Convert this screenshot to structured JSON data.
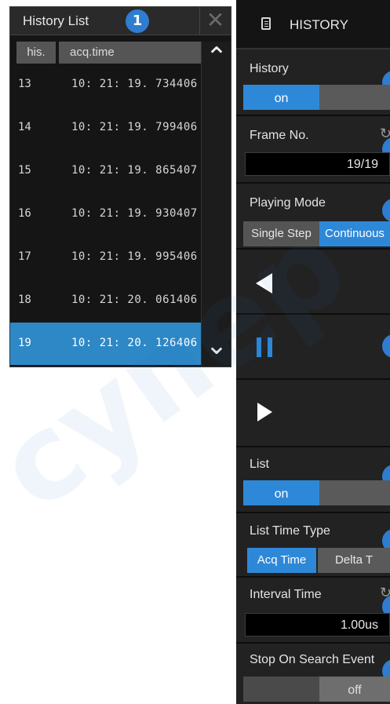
{
  "history_list": {
    "title": "History List",
    "badge": "1",
    "close_glyph": "✕",
    "columns": [
      "his.",
      "acq.time"
    ],
    "rows": [
      {
        "his": "13",
        "time": "10: 21: 19. 734406"
      },
      {
        "his": "14",
        "time": "10: 21: 19. 799406"
      },
      {
        "his": "15",
        "time": "10: 21: 19. 865407"
      },
      {
        "his": "16",
        "time": "10: 21: 19. 930407"
      },
      {
        "his": "17",
        "time": "10: 21: 19. 995406"
      },
      {
        "his": "18",
        "time": "10: 21: 20. 061406"
      },
      {
        "his": "19",
        "time": "10: 21: 20. 126406"
      }
    ],
    "selected_row": "19",
    "scroll_up_glyph": "⌃",
    "scroll_down_glyph": "⌄"
  },
  "panel": {
    "header": "HISTORY",
    "header_icon": "document-icon",
    "history": {
      "label": "History",
      "state": "on"
    },
    "frame_no": {
      "label": "Frame No.",
      "value": "19/19"
    },
    "playing_mode": {
      "label": "Playing Mode",
      "options": [
        "Single Step",
        "Continuous"
      ],
      "selected": "Continuous"
    },
    "play_controls": [
      "play-backward-icon",
      "pause-icon",
      "play-forward-icon"
    ],
    "list": {
      "label": "List",
      "state": "on"
    },
    "list_time_type": {
      "label": "List Time Type",
      "options": [
        "Acq Time",
        "Delta T"
      ],
      "selected": "Acq Time"
    },
    "interval_time": {
      "label": "Interval Time",
      "value": "1.00us"
    },
    "stop_on_search_event": {
      "label": "Stop On Search Event",
      "state": "off"
    }
  },
  "colors": {
    "accent": "#2e88d8",
    "panel_bg": "#1f1f1f",
    "list_bg": "#151515",
    "selected_row": "#2e88c6"
  },
  "watermark": "супер"
}
